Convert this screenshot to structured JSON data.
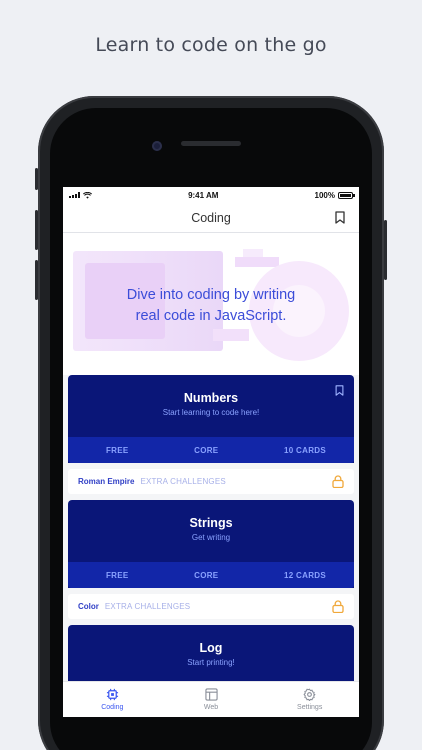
{
  "headline": "Learn to code on the go",
  "status": {
    "time": "9:41 AM",
    "battery": "100%"
  },
  "nav": {
    "title": "Coding"
  },
  "hero": {
    "line1": "Dive into coding by writing",
    "line2": "real code in JavaScript."
  },
  "courses": [
    {
      "title": "Numbers",
      "subtitle": "Start learning to code here!",
      "price": "FREE",
      "level": "CORE",
      "cards": "10 CARDS",
      "challenge": {
        "name": "Roman Empire",
        "tag": "EXTRA CHALLENGES"
      }
    },
    {
      "title": "Strings",
      "subtitle": "Get writing",
      "price": "FREE",
      "level": "CORE",
      "cards": "12 CARDS",
      "challenge": {
        "name": "Color",
        "tag": "EXTRA CHALLENGES"
      }
    },
    {
      "title": "Log",
      "subtitle": "Start printing!"
    }
  ],
  "tabs": [
    {
      "label": "Coding"
    },
    {
      "label": "Web"
    },
    {
      "label": "Settings"
    }
  ],
  "colors": {
    "card": "#0a1678",
    "card_meta": "#1226a8",
    "accent": "#3a56f0",
    "lock": "#f0a83a"
  }
}
